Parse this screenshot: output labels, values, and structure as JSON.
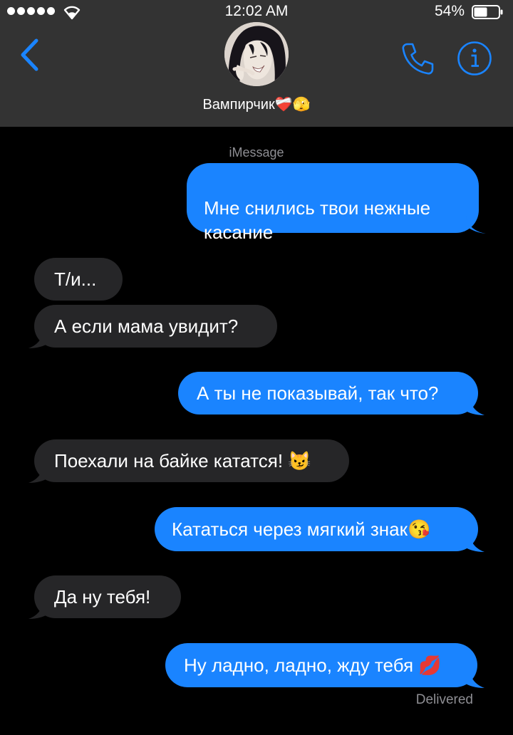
{
  "status_bar": {
    "time": "12:02 AM",
    "battery_percent": "54%"
  },
  "header": {
    "contact_name": "Вампирчик❤️‍🩹🫣",
    "back_icon": "chevron-left-icon",
    "call_icon": "phone-icon",
    "info_icon": "info-icon"
  },
  "conversation": {
    "service_label": "iMessage",
    "messages": [
      {
        "direction": "outgoing",
        "text": "Мне снились твои нежные\nкасание"
      },
      {
        "direction": "incoming",
        "text": "Т/и..."
      },
      {
        "direction": "incoming",
        "text": "А если мама увидит?"
      },
      {
        "direction": "outgoing",
        "text": "А ты не показывай, так что?"
      },
      {
        "direction": "incoming",
        "text": "Поехали на байке кататся! 😼"
      },
      {
        "direction": "outgoing",
        "text": "Кататься через мягкий знак😘"
      },
      {
        "direction": "incoming",
        "text": "Да ну тебя!"
      },
      {
        "direction": "outgoing",
        "text": "Ну ладно, ладно, жду тебя 💋"
      }
    ],
    "status": "Delivered"
  },
  "colors": {
    "header_bg": "#333333",
    "outgoing_bubble": "#1a84ff",
    "incoming_bubble": "#262628",
    "accent": "#1a84ff"
  }
}
